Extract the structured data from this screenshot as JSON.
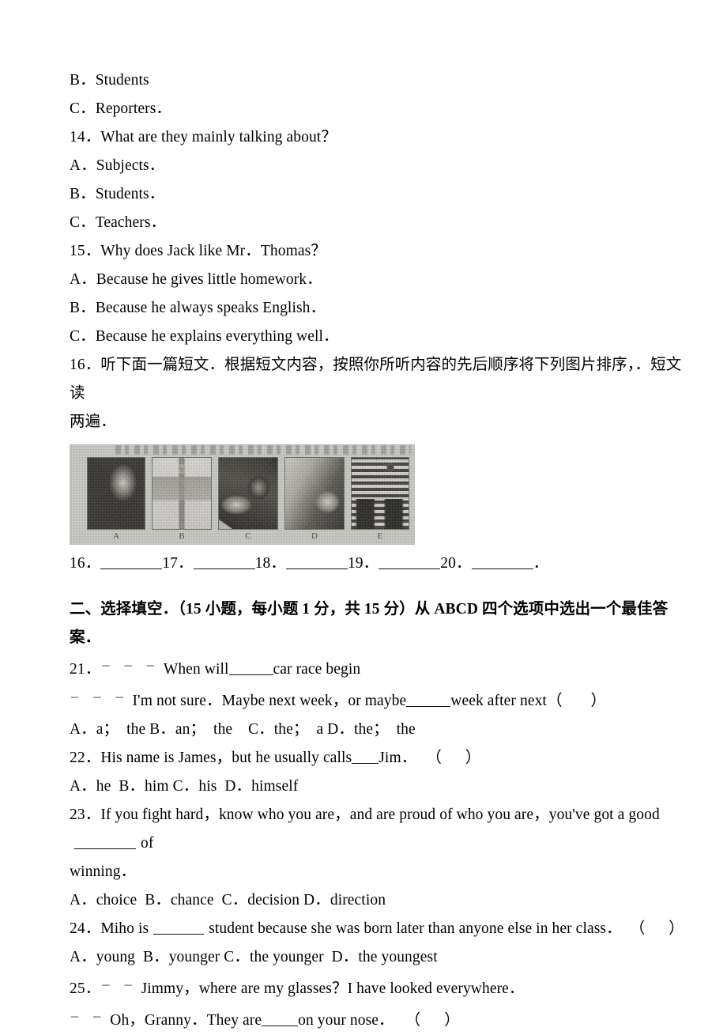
{
  "document": {
    "listening_options": [
      "B．Students",
      "C．Reporters．"
    ],
    "question_14": {
      "stem": "14．What are they mainly talking about？",
      "options": [
        "A．Subjects．",
        "B．Students．",
        "C．Teachers．"
      ]
    },
    "question_15": {
      "stem": "15．Why does Jack like Mr．Thomas？",
      "options": [
        "A．Because he gives little homework．",
        "B．Because he always speaks English．",
        "C．Because he explains everything well．"
      ]
    },
    "question_16": {
      "stem_line1": "16．听下面一篇短文．根据短文内容，按照你所听内容的先后顺序将下列图片排序，．短文读",
      "stem_line2": "两遍．",
      "image_captions": [
        "A",
        "B",
        "C",
        "D",
        "E"
      ],
      "answer_numbers": [
        "16．",
        "17．",
        "18．",
        "19．",
        "20．"
      ],
      "answer_trailing": "．"
    },
    "section_two": {
      "heading_line1": "二、选择填空．（15 小题，每小题 1 分，共 15 分）从 ABCD 四个选项中选出一个最佳答",
      "heading_line2": "案．"
    },
    "question_21": {
      "number": "21．",
      "dash": "－ － －",
      "stem_before": "When will",
      "stem_after": "car race begin",
      "reply_dash": "－ － －",
      "reply_before": "I'm not sure．Maybe next week，or maybe",
      "reply_after": "week after next",
      "bracket_open": "（",
      "bracket_close": "）",
      "options": "A．a；  the B．an；  the    C．the；  a D．the；  the"
    },
    "question_22": {
      "number": "22．",
      "stem_before": "His name is James，but he usually calls",
      "stem_after": "Jim．",
      "bracket_open": "（",
      "bracket_close": "）",
      "options": "A．he  B．him C．his  D．himself"
    },
    "question_23": {
      "number": "23．",
      "stem_before": "If you fight hard，know who you are，and are proud of who you are，you've got a good",
      "stem_after": "of",
      "stem_line2": "winning．",
      "options": "A．choice  B．chance  C．decision D．direction"
    },
    "question_24": {
      "number": "24．",
      "stem_before": "Miho is",
      "stem_after": "student because she was born later than anyone else in her class．",
      "bracket_open": "（",
      "bracket_close": "）",
      "options": "A．young  B．younger C．the younger  D．the youngest"
    },
    "question_25": {
      "number": "25．",
      "dash": "－ －",
      "stem": "Jimmy，where are my glasses？I have looked everywhere．",
      "reply_dash": "－ －",
      "reply_before": "Oh，Granny．They are",
      "reply_after": "on your nose．",
      "bracket_open": "（",
      "bracket_close": "）"
    }
  },
  "colors": {
    "page_background": "#ffffff",
    "text": "#000000",
    "strip_background": "#c9c9c4",
    "photo_border": "#6d6d68"
  }
}
